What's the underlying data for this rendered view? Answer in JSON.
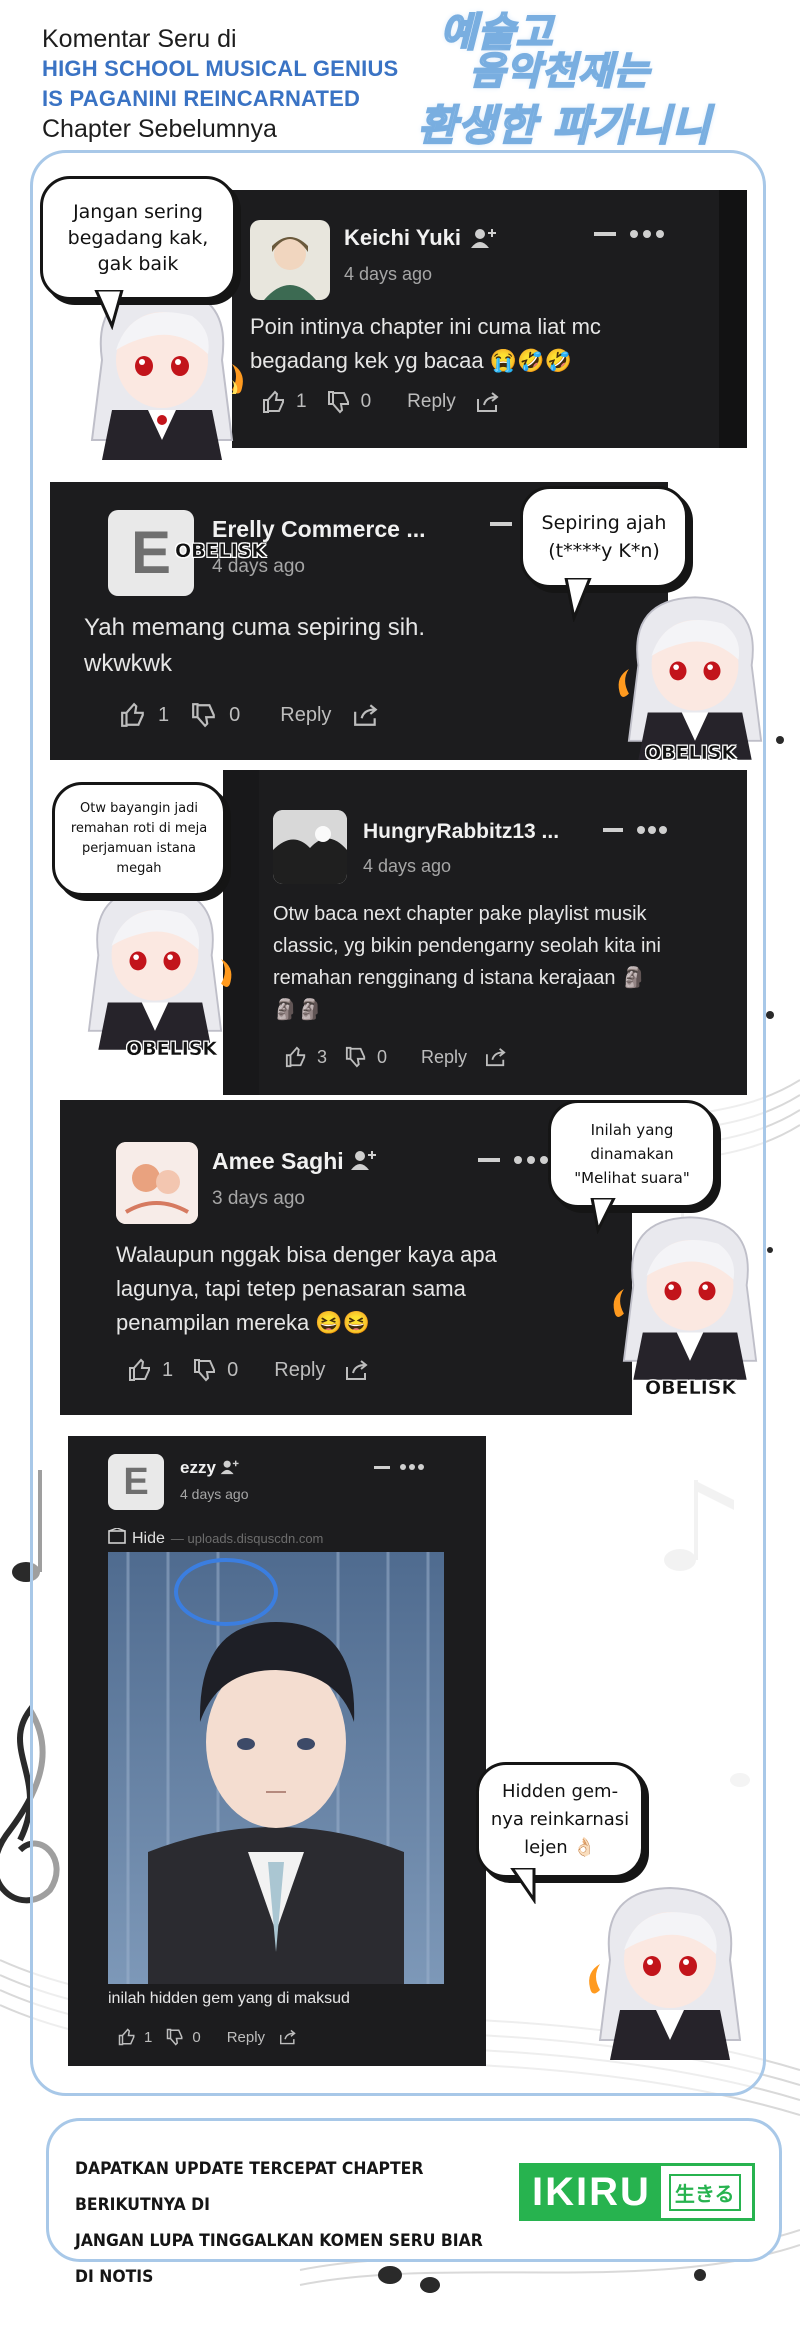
{
  "header": {
    "intro": "Komentar Seru di",
    "title_line1": "HIGH SCHOOL MUSICAL GENIUS",
    "title_line2": "IS PAGANINI REINCARNATED",
    "subtitle": "Chapter Sebelumnya",
    "korean_line1": "예술고",
    "korean_line2": "음악천재는",
    "korean_line3": "환생한 파가니니"
  },
  "comments": [
    {
      "username": "Keichi Yuki",
      "time": "4 days ago",
      "body_line1": "Poin intinya chapter ini cuma liat mc",
      "body_line2": "begadang kek yg bacaa 😭🤣🤣",
      "likes": "1",
      "dislikes": "0",
      "reply": "Reply"
    },
    {
      "username": "Erelly Commerce ...",
      "avatar_letter": "E",
      "time": "4 days ago",
      "body_line1": "Yah memang cuma sepiring sih.",
      "body_line2": "wkwkwk",
      "likes": "1",
      "dislikes": "0",
      "reply": "Reply"
    },
    {
      "username": "HungryRabbitz13 ...",
      "time": "4 days ago",
      "body_line1": "Otw baca next chapter pake playlist musik",
      "body_line2": "classic, yg bikin pendengarny seolah kita ini",
      "body_line3": "remahan rengginang d istana kerajaan 🗿",
      "body_line4": "🗿🗿",
      "likes": "3",
      "dislikes": "0",
      "reply": "Reply"
    },
    {
      "username": "Amee Saghi",
      "time": "3 days ago",
      "body_line1": "Walaupun nggak bisa denger kaya apa",
      "body_line2": "lagunya, tapi tetep penasaran sama",
      "body_line3": "penampilan mereka 😆😆",
      "likes": "1",
      "dislikes": "0",
      "reply": "Reply"
    },
    {
      "username": "ezzy",
      "avatar_letter": "E",
      "time": "4 days ago",
      "hide_label": "Hide",
      "hide_source": "— uploads.disquscdn.com",
      "caption": "inilah hidden gem yang di maksud",
      "likes": "1",
      "dislikes": "0",
      "reply": "Reply"
    }
  ],
  "bubbles": [
    {
      "line1": "Jangan sering",
      "line2": "begadang kak,",
      "line3": "gak baik"
    },
    {
      "line1": "Sepiring ajah",
      "line2": "(t****y K*n)"
    },
    {
      "line1": "Otw bayangin jadi",
      "line2": "remahan roti di meja",
      "line3": "perjamuan istana",
      "line4": "megah"
    },
    {
      "line1": "Inilah yang",
      "line2": "dinamakan",
      "line3": "\"Melihat suara\""
    },
    {
      "line1": "Hidden gem-",
      "line2": "nya reinkarnasi",
      "line3": "lejen 👌🏻"
    }
  ],
  "watermark": "OBELISK",
  "footer": {
    "line1": "DAPATKAN UPDATE TERCEPAT CHAPTER BERIKUTNYA DI",
    "line2": "JANGAN LUPA TINGGALKAN KOMEN SERU BIAR DI NOTIS",
    "brand": "IKIRU",
    "brand_kana": "生きる"
  },
  "colors": {
    "accent_blue": "#3a73c4",
    "frame_blue": "#a8c8e8",
    "card_dark": "#1c1c1e",
    "brand_green": "#27b34f"
  }
}
